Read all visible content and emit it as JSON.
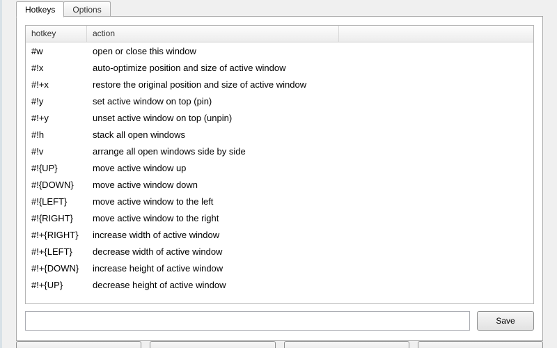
{
  "tabs": {
    "hotkeys": "Hotkeys",
    "options": "Options"
  },
  "columns": {
    "hotkey": "hotkey",
    "action": "action"
  },
  "rows": [
    {
      "hotkey": "#w",
      "action": "open or close this window"
    },
    {
      "hotkey": "#!x",
      "action": "auto-optimize position and size of active window"
    },
    {
      "hotkey": "#!+x",
      "action": "restore the original position and size of active window"
    },
    {
      "hotkey": "#!y",
      "action": "set active window on top (pin)"
    },
    {
      "hotkey": "#!+y",
      "action": "unset active window on top (unpin)"
    },
    {
      "hotkey": "#!h",
      "action": "stack all open windows"
    },
    {
      "hotkey": "#!v",
      "action": "arrange all open windows side by side"
    },
    {
      "hotkey": "#!{UP}",
      "action": "move active window up"
    },
    {
      "hotkey": "#!{DOWN}",
      "action": "move active window down"
    },
    {
      "hotkey": "#!{LEFT}",
      "action": "move active window to the left"
    },
    {
      "hotkey": "#!{RIGHT}",
      "action": "move active window to the right"
    },
    {
      "hotkey": "#!+{RIGHT}",
      "action": "increase width of active window"
    },
    {
      "hotkey": "#!+{LEFT}",
      "action": "decrease width of active window"
    },
    {
      "hotkey": "#!+{DOWN}",
      "action": "increase height of active window"
    },
    {
      "hotkey": "#!+{UP}",
      "action": "decrease height of active window"
    }
  ],
  "bottom": {
    "input_value": "",
    "save_label": "Save"
  }
}
